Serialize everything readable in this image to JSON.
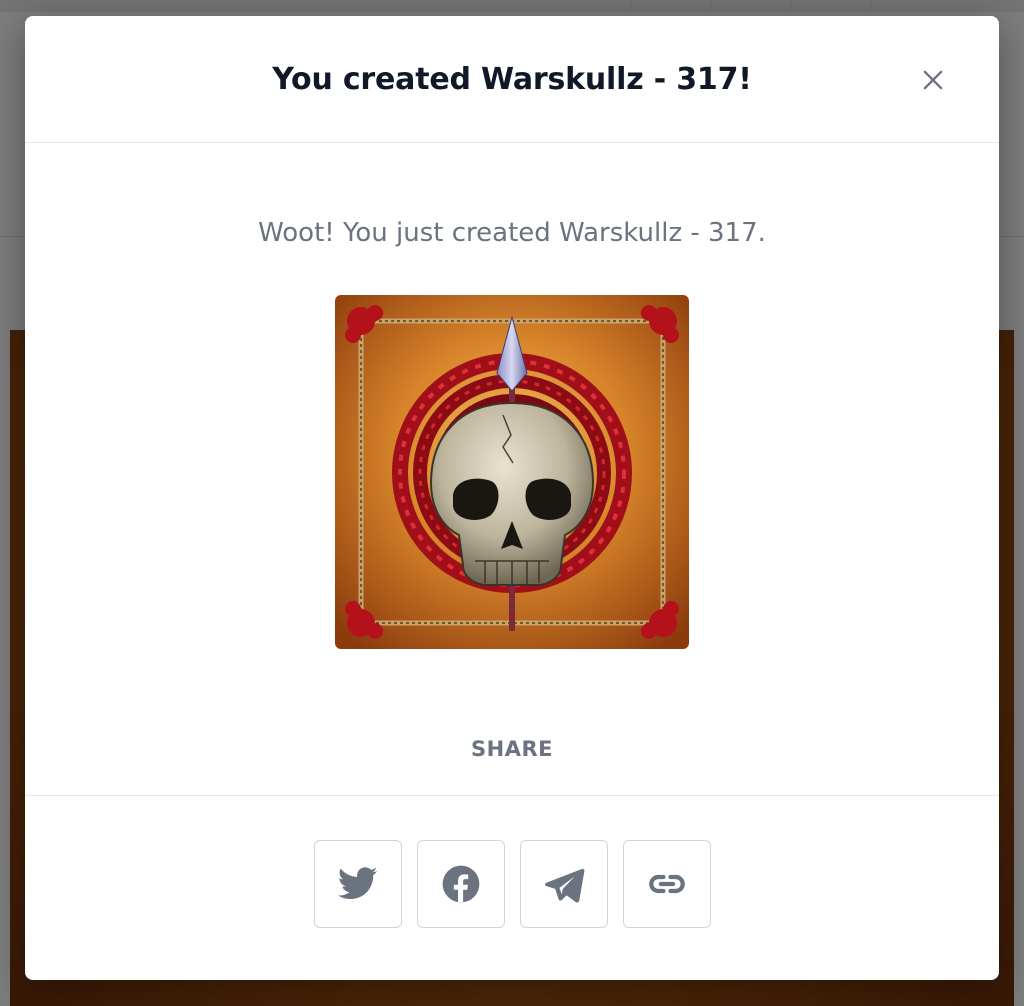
{
  "modal": {
    "title": "You created Warskullz - 317!",
    "message": "Woot! You just created Warskullz - 317.",
    "share_label": "SHARE"
  },
  "icons": {
    "close": "close-icon",
    "share_buttons": [
      "twitter-icon",
      "facebook-icon",
      "telegram-icon",
      "link-icon"
    ]
  },
  "colors": {
    "title": "#111827",
    "muted_text": "#6b7280",
    "icon": "#6b7280",
    "border": "#d1d5db"
  }
}
